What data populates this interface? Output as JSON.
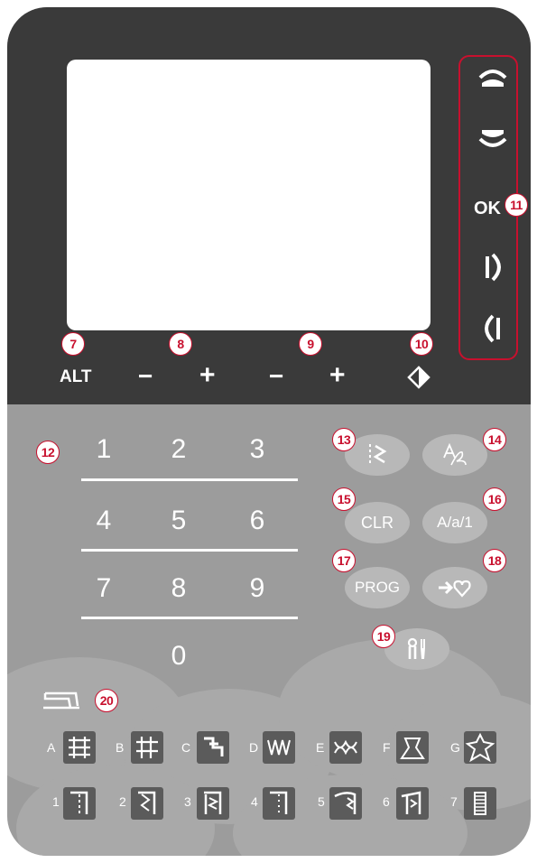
{
  "callouts": [
    "7",
    "8",
    "9",
    "10",
    "11",
    "12",
    "13",
    "14",
    "15",
    "16",
    "17",
    "18",
    "19",
    "20"
  ],
  "controls": {
    "alt": "ALT",
    "minus": "−",
    "plus": "+",
    "ok": "OK"
  },
  "keypad": {
    "keys": [
      "1",
      "2",
      "3",
      "4",
      "5",
      "6",
      "7",
      "8",
      "9",
      "0"
    ]
  },
  "buttons": {
    "clr": "CLR",
    "case": "A/a/1",
    "prog": "PROG"
  },
  "stitch_letters": [
    "A",
    "B",
    "C",
    "D",
    "E",
    "F",
    "G"
  ],
  "stitch_numbers": [
    "1",
    "2",
    "3",
    "4",
    "5",
    "6",
    "7"
  ],
  "colors": {
    "panel_top": "#3a3a3a",
    "panel_bottom": "#9c9c9c",
    "callout": "#c8102e"
  },
  "icons": [
    "arrow-up-icon",
    "arrow-down-icon",
    "arrow-right-icon",
    "arrow-left-icon",
    "mirror-icon",
    "stitch-menu-icon",
    "font-menu-icon",
    "favorites-icon",
    "settings-icon",
    "machine-icon"
  ]
}
